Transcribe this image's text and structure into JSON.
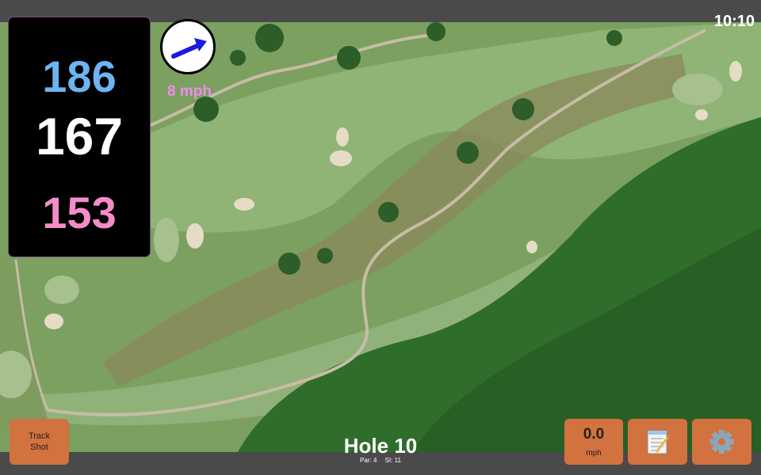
{
  "status": {
    "time": "10:10"
  },
  "distances": {
    "back": "186",
    "middle": "167",
    "front": "153",
    "back_color": "#6cb4f2",
    "middle_color": "#ffffff",
    "front_color": "#f48cc8"
  },
  "wind": {
    "speed_label": "8 mph",
    "speed_color": "#f08cf0",
    "arrow_color": "#1a1ae0",
    "arrow_icon": "arrow-right-icon"
  },
  "hole": {
    "title": "Hole 10",
    "par": "Par: 4",
    "si": "SI: 11"
  },
  "buttons": {
    "track_shot": "Track\nShot",
    "speed_value": "0.0",
    "speed_unit": "mph",
    "notes_icon": "notes-icon",
    "settings_icon": "gear-icon",
    "button_color": "#d2723e"
  },
  "map": {
    "fairway_color": "#8db073",
    "rough_color": "#6e9a52",
    "forest_color": "#2e6e2c",
    "bunker_color": "#e6dcc6",
    "path_color": "#c8bca6"
  }
}
